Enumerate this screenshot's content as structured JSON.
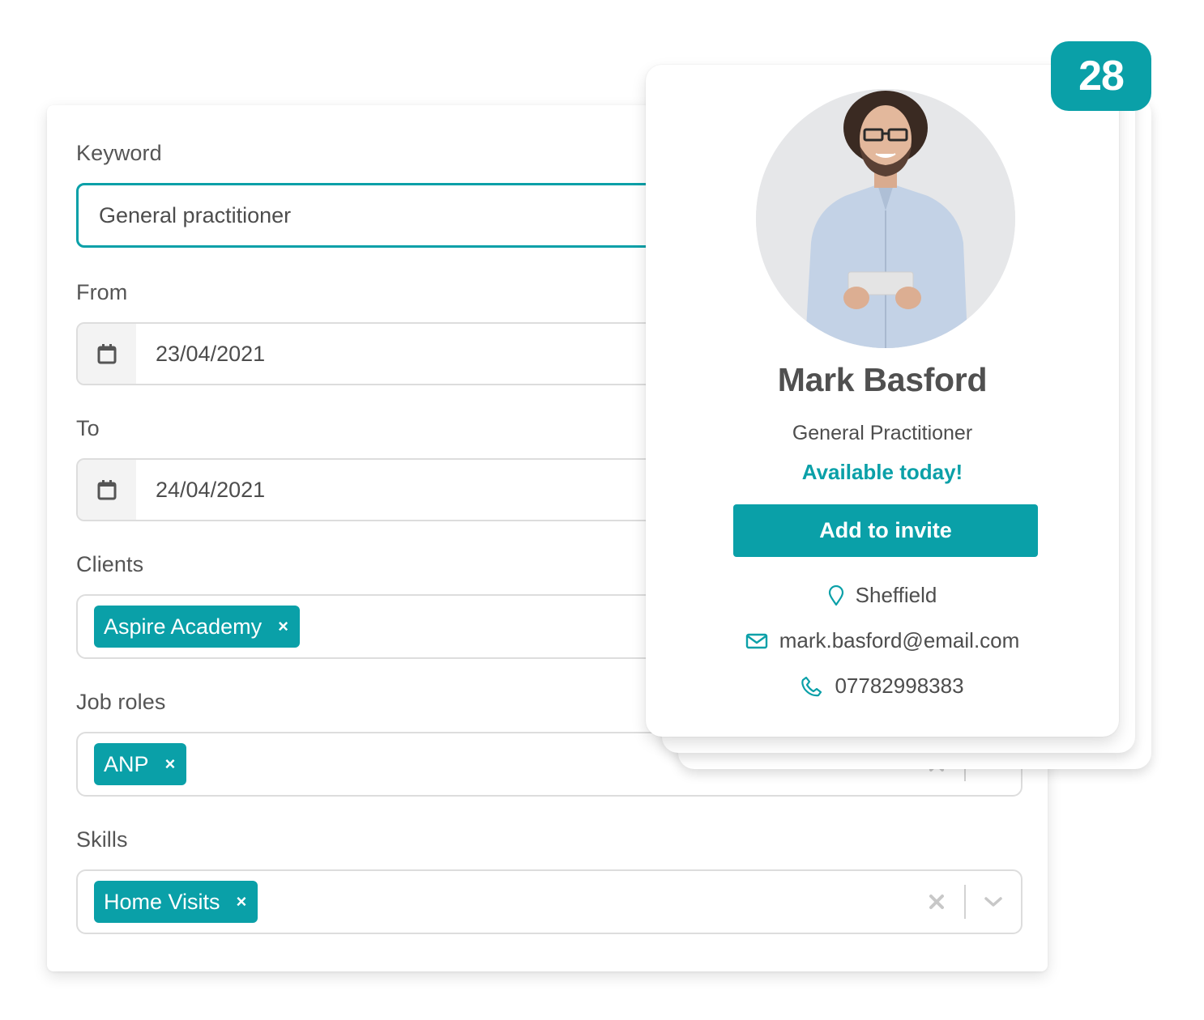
{
  "filters": {
    "keyword": {
      "label": "Keyword",
      "value": "General practitioner"
    },
    "from": {
      "label": "From",
      "value": "23/04/2021",
      "icon": "calendar-icon"
    },
    "to": {
      "label": "To",
      "value": "24/04/2021",
      "icon": "calendar-icon"
    },
    "clients": {
      "label": "Clients",
      "chips": [
        {
          "label": "Aspire Academy",
          "remove": "×"
        }
      ]
    },
    "job_roles": {
      "label": "Job roles",
      "chips": [
        {
          "label": "ANP",
          "remove": "×"
        }
      ]
    },
    "skills": {
      "label": "Skills",
      "chips": [
        {
          "label": "Home Visits",
          "remove": "×"
        }
      ]
    }
  },
  "results_count": "28",
  "profile": {
    "name": "Mark Basford",
    "role": "General Practitioner",
    "availability": "Available today!",
    "action_label": "Add to invite",
    "location": "Sheffield",
    "email": "mark.basford@email.com",
    "phone": "07782998383"
  },
  "colors": {
    "accent": "#0aa0a8",
    "text": "#4d4d4d",
    "border": "#dddddd"
  }
}
